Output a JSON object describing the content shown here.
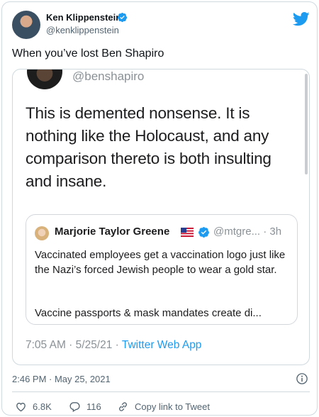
{
  "author": {
    "name": "Ken Klippenstein",
    "handle": "@kenklippenstein"
  },
  "tweet": {
    "text": "When you’ve lost Ben Shapiro"
  },
  "embedded": {
    "handle": "@benshapiro",
    "text": "This is demented nonsense. It is nothing like the Holocaust, and any comparison thereto is both insulting and insane.",
    "quote": {
      "name": "Marjorie Taylor Greene",
      "handle_time": "@mtgre... · 3h",
      "text1": "Vaccinated employees get a vaccination logo just like the Nazi’s forced Jewish people to wear a gold star.",
      "text2": "Vaccine passports & mask mandates create di..."
    },
    "meta_time": "7:05 AM · 5/25/21 · ",
    "meta_app": "Twitter Web App"
  },
  "footer": {
    "timestamp": "2:46 PM · May 25, 2021",
    "likes": "6.8K",
    "replies": "116",
    "copy_link": "Copy link to Tweet"
  },
  "colors": {
    "twitter_blue": "#1d9bf0",
    "secondary_text": "#536471"
  },
  "icons": [
    "verified-icon",
    "twitter-bird-icon",
    "us-flag-icon",
    "info-icon",
    "heart-icon",
    "reply-icon",
    "link-icon"
  ]
}
